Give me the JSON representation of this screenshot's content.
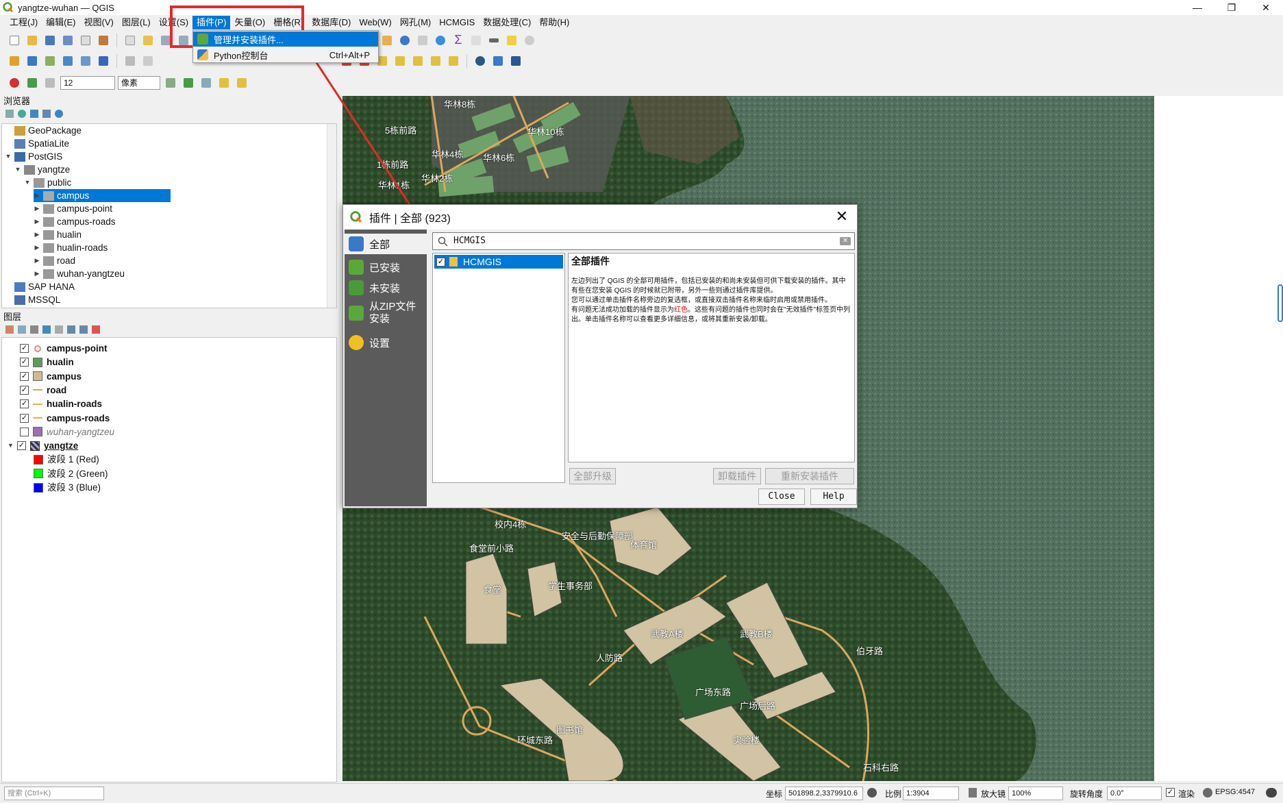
{
  "window": {
    "title": "yangtze-wuhan — QGIS",
    "controls": [
      "—",
      "❐",
      "✕"
    ]
  },
  "menu": [
    "工程(J)",
    "编辑(E)",
    "视图(V)",
    "图层(L)",
    "设置(S)",
    "插件(P)",
    "矢量(O)",
    "栅格(R)",
    "数据库(D)",
    "Web(W)",
    "网孔(M)",
    "HCMGIS",
    "数据处理(C)",
    "帮助(H)"
  ],
  "plugin_menu": {
    "items": [
      {
        "label": "管理并安装插件...",
        "shortcut": ""
      },
      {
        "label": "Python控制台",
        "shortcut": "Ctrl+Alt+P"
      }
    ]
  },
  "snapping": {
    "tolerance": "12",
    "unit": "像素"
  },
  "browser": {
    "title": "浏览器",
    "items": [
      {
        "label": "GeoPackage",
        "depth": 0,
        "arrow": "",
        "icon": "geopackage-icon",
        "color": "#c9a03a"
      },
      {
        "label": "SpatiaLite",
        "depth": 0,
        "arrow": "",
        "icon": "feather-icon",
        "color": "#5a7fb8"
      },
      {
        "label": "PostGIS",
        "depth": 0,
        "arrow": "▼",
        "icon": "elephant-icon",
        "color": "#3b6aa8"
      },
      {
        "label": "yangtze",
        "depth": 1,
        "arrow": "▼",
        "icon": "connection-icon",
        "color": "#888"
      },
      {
        "label": "public",
        "depth": 2,
        "arrow": "▼",
        "icon": "schema-icon",
        "color": "#999"
      },
      {
        "label": "campus",
        "depth": 3,
        "arrow": "▶",
        "icon": "polygon-icon",
        "color": "#aaa",
        "selected": true
      },
      {
        "label": "campus-point",
        "depth": 3,
        "arrow": "▶",
        "icon": "point-icon",
        "color": "#999"
      },
      {
        "label": "campus-roads",
        "depth": 3,
        "arrow": "▶",
        "icon": "line-icon",
        "color": "#999"
      },
      {
        "label": "hualin",
        "depth": 3,
        "arrow": "▶",
        "icon": "polygon-icon",
        "color": "#999"
      },
      {
        "label": "hualin-roads",
        "depth": 3,
        "arrow": "▶",
        "icon": "line-icon",
        "color": "#999"
      },
      {
        "label": "road",
        "depth": 3,
        "arrow": "▶",
        "icon": "line-icon",
        "color": "#999"
      },
      {
        "label": "wuhan-yangtzeu",
        "depth": 3,
        "arrow": "▶",
        "icon": "polygon-icon",
        "color": "#999"
      },
      {
        "label": "SAP HANA",
        "depth": 0,
        "arrow": "",
        "icon": "hana-icon",
        "color": "#4a7bc0"
      },
      {
        "label": "MSSQL",
        "depth": 0,
        "arrow": "",
        "icon": "mssql-icon",
        "color": "#4a6ea8"
      }
    ]
  },
  "layers": {
    "title": "图层",
    "items": [
      {
        "label": "campus-point",
        "checked": "✓",
        "color": "#f08080",
        "kind": "point",
        "bold": true
      },
      {
        "label": "hualin",
        "checked": "✓",
        "color": "#5f9a5a",
        "kind": "fill",
        "bold": true
      },
      {
        "label": "campus",
        "checked": "✓",
        "color": "#cdbb96",
        "kind": "fill",
        "bold": true
      },
      {
        "label": "road",
        "checked": "✓",
        "color": "#d9a55c",
        "kind": "line",
        "bold": true
      },
      {
        "label": "hualin-roads",
        "checked": "✓",
        "color": "#e0b060",
        "kind": "line",
        "bold": true
      },
      {
        "label": "campus-roads",
        "checked": "✓",
        "color": "#e0b060",
        "kind": "line",
        "bold": true
      },
      {
        "label": "wuhan-yangtzeu",
        "checked": "",
        "color": "#9b6fb0",
        "kind": "fill",
        "italic": true
      },
      {
        "label": "yangtze",
        "checked": "✓",
        "color": "#335",
        "kind": "raster",
        "bold": true,
        "underline": true
      },
      {
        "label": "波段 1 (Red)",
        "checked": "",
        "color": "#ff0000",
        "kind": "band"
      },
      {
        "label": "波段 2 (Green)",
        "checked": "",
        "color": "#00ff00",
        "kind": "band"
      },
      {
        "label": "波段 3 (Blue)",
        "checked": "",
        "color": "#0000ff",
        "kind": "band"
      }
    ]
  },
  "dialog": {
    "title": "插件 | 全部 (923)",
    "close": "✕",
    "sidebar": [
      "全部",
      "已安装",
      "未安装",
      "从ZIP文件安装",
      "设置"
    ],
    "sidebar_zip_lines": [
      "从ZIP文件",
      "安装"
    ],
    "search_value": "HCMGIS",
    "plugins": [
      {
        "name": "HCMGIS",
        "checked": "✓"
      }
    ],
    "desc_title": "全部插件",
    "desc_p1": "左边列出了 QGIS 的全部可用插件，包括已安装的和尚未安装但可供下载安装的插件。其中有些在您安装 QGIS 的时候就已附带，另外一些则通过插件库提供。",
    "desc_p2": "您可以通过单击插件名称旁边的复选框，或直接双击插件名称来临时启用或禁用插件。",
    "desc_p3_a": "有问题无法成功加载的插件显示为",
    "desc_p3_red": "红色",
    "desc_p3_b": "。这些有问题的插件也同时会在\"无效插件\"标签页中列出。单击插件名称可以查看更多详细信息，或将其重新安装/卸载。",
    "btn_upgrade_all": "全部升级",
    "btn_uninstall": "卸载插件",
    "btn_reinstall": "重新安装插件",
    "btn_close": "Close",
    "btn_help": "Help"
  },
  "map_labels": [
    "华林8栋",
    "华林10栋",
    "华林1栋",
    "华林2栋",
    "华林4栋",
    "华林6栋",
    "1栋前路",
    "5栋前路",
    "校内4栋",
    "食堂",
    "体育馆",
    "学生事务部",
    "武教A楼",
    "武教B楼",
    "图书馆",
    "实验楼",
    "广场东路",
    "广场后路",
    "伯牙路",
    "石科右路",
    "环城东路",
    "人防路",
    "食堂前小路",
    "安全与后勤保障部"
  ],
  "status": {
    "search_placeholder": "搜索 (Ctrl+K)",
    "coord_label": "坐标",
    "coord_value": "501898.2,3379910.6",
    "scale_label": "比例",
    "scale_value": "1:3904",
    "magnifier_label": "放大镜",
    "magnifier_value": "100%",
    "rotation_label": "旋转角度",
    "rotation_value": "0.0°",
    "render_label": "渲染",
    "crs": "EPSG:4547"
  },
  "colors": {
    "accent": "#0078d7",
    "highlight_red": "#e6282a",
    "sidebar_dark": "#5b5b5b"
  }
}
